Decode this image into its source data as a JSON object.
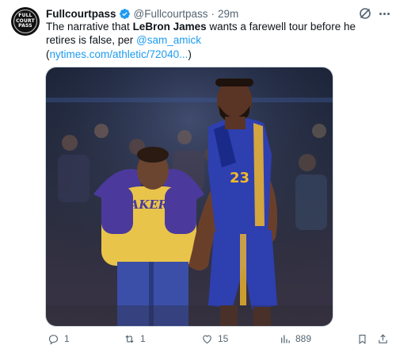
{
  "account": {
    "display_name": "Fullcourtpass",
    "handle": "@Fullcourtpass",
    "time": "29m",
    "separator": "·",
    "avatar_text": [
      "FULL",
      "COURT",
      "PASS"
    ]
  },
  "tweet": {
    "text_part1": "The narrative that ",
    "text_bold": "LeBron James",
    "text_part2": " wants a farewell tour before he retires is false, per ",
    "mention": "@sam_amick",
    "link_open": "(",
    "link_text": "nytimes.com/athletic/72040...",
    "link_close": ")",
    "image_jersey_text": "LAKERS"
  },
  "actions": {
    "replies": "1",
    "retweets": "1",
    "likes": "15",
    "views": "889"
  },
  "colors": {
    "accent": "#1d9bf0",
    "text": "#0f1419",
    "secondary": "#536471",
    "lakers_gold": "#f1b82d",
    "lakers_purple": "#4b3a9c"
  }
}
